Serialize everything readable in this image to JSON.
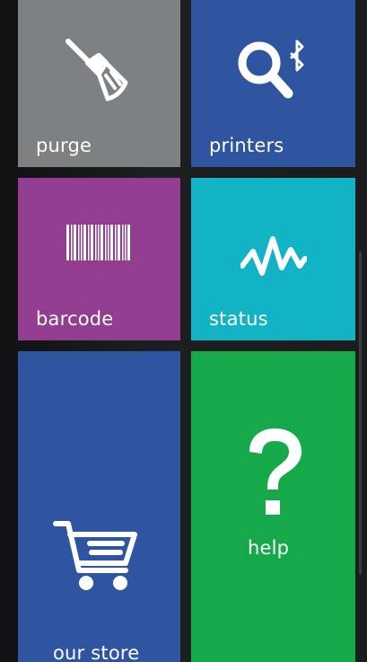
{
  "tiles": {
    "purge": {
      "label": "purge",
      "icon": "broom-icon",
      "color": "#7d8184"
    },
    "printers": {
      "label": "printers",
      "icon": "search-bluetooth-icon",
      "color": "#2f55a0"
    },
    "barcode": {
      "label": "barcode",
      "icon": "barcode-icon",
      "color": "#933d90"
    },
    "status": {
      "label": "status",
      "icon": "pulse-icon",
      "color": "#11b3c4"
    },
    "store": {
      "label": "our store",
      "icon": "shopping-cart-icon",
      "color": "#2f55a0"
    },
    "help": {
      "label": "help",
      "icon": "question-mark-icon",
      "color": "#16a94a"
    }
  }
}
